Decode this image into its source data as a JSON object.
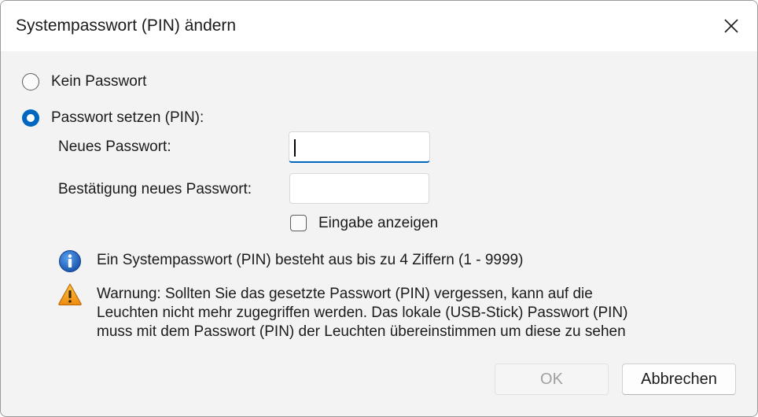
{
  "window": {
    "title": "Systempasswort (PIN) ändern",
    "close_icon": "close-icon"
  },
  "options": {
    "no_password": {
      "label": "Kein Passwort",
      "selected": false
    },
    "set_password": {
      "label": "Passwort setzen (PIN):",
      "selected": true
    }
  },
  "fields": {
    "new_password": {
      "label": "Neues Passwort:",
      "value": ""
    },
    "confirm_password": {
      "label": "Bestätigung neues Passwort:",
      "value": ""
    }
  },
  "show_input": {
    "label": "Eingabe anzeigen",
    "checked": false
  },
  "messages": {
    "info_icon": "info-icon",
    "info": "Ein Systempasswort (PIN) besteht aus bis zu 4 Ziffern (1 - 9999)",
    "warning_icon": "warning-icon",
    "warning_lines": [
      "Warnung: Sollten Sie das gesetzte Passwort (PIN) vergessen, kann auf die",
      "Leuchten nicht mehr zugegriffen werden. Das lokale (USB-Stick) Passwort (PIN)",
      "muss mit dem Passwort (PIN) der Leuchten übereinstimmen um diese zu sehen"
    ]
  },
  "buttons": {
    "ok": {
      "label": "OK",
      "enabled": false
    },
    "cancel": {
      "label": "Abbrechen",
      "enabled": true
    }
  },
  "colors": {
    "accent": "#0067c0",
    "info_blue": "#1c62b9",
    "warning_orange": "#f39c12"
  }
}
